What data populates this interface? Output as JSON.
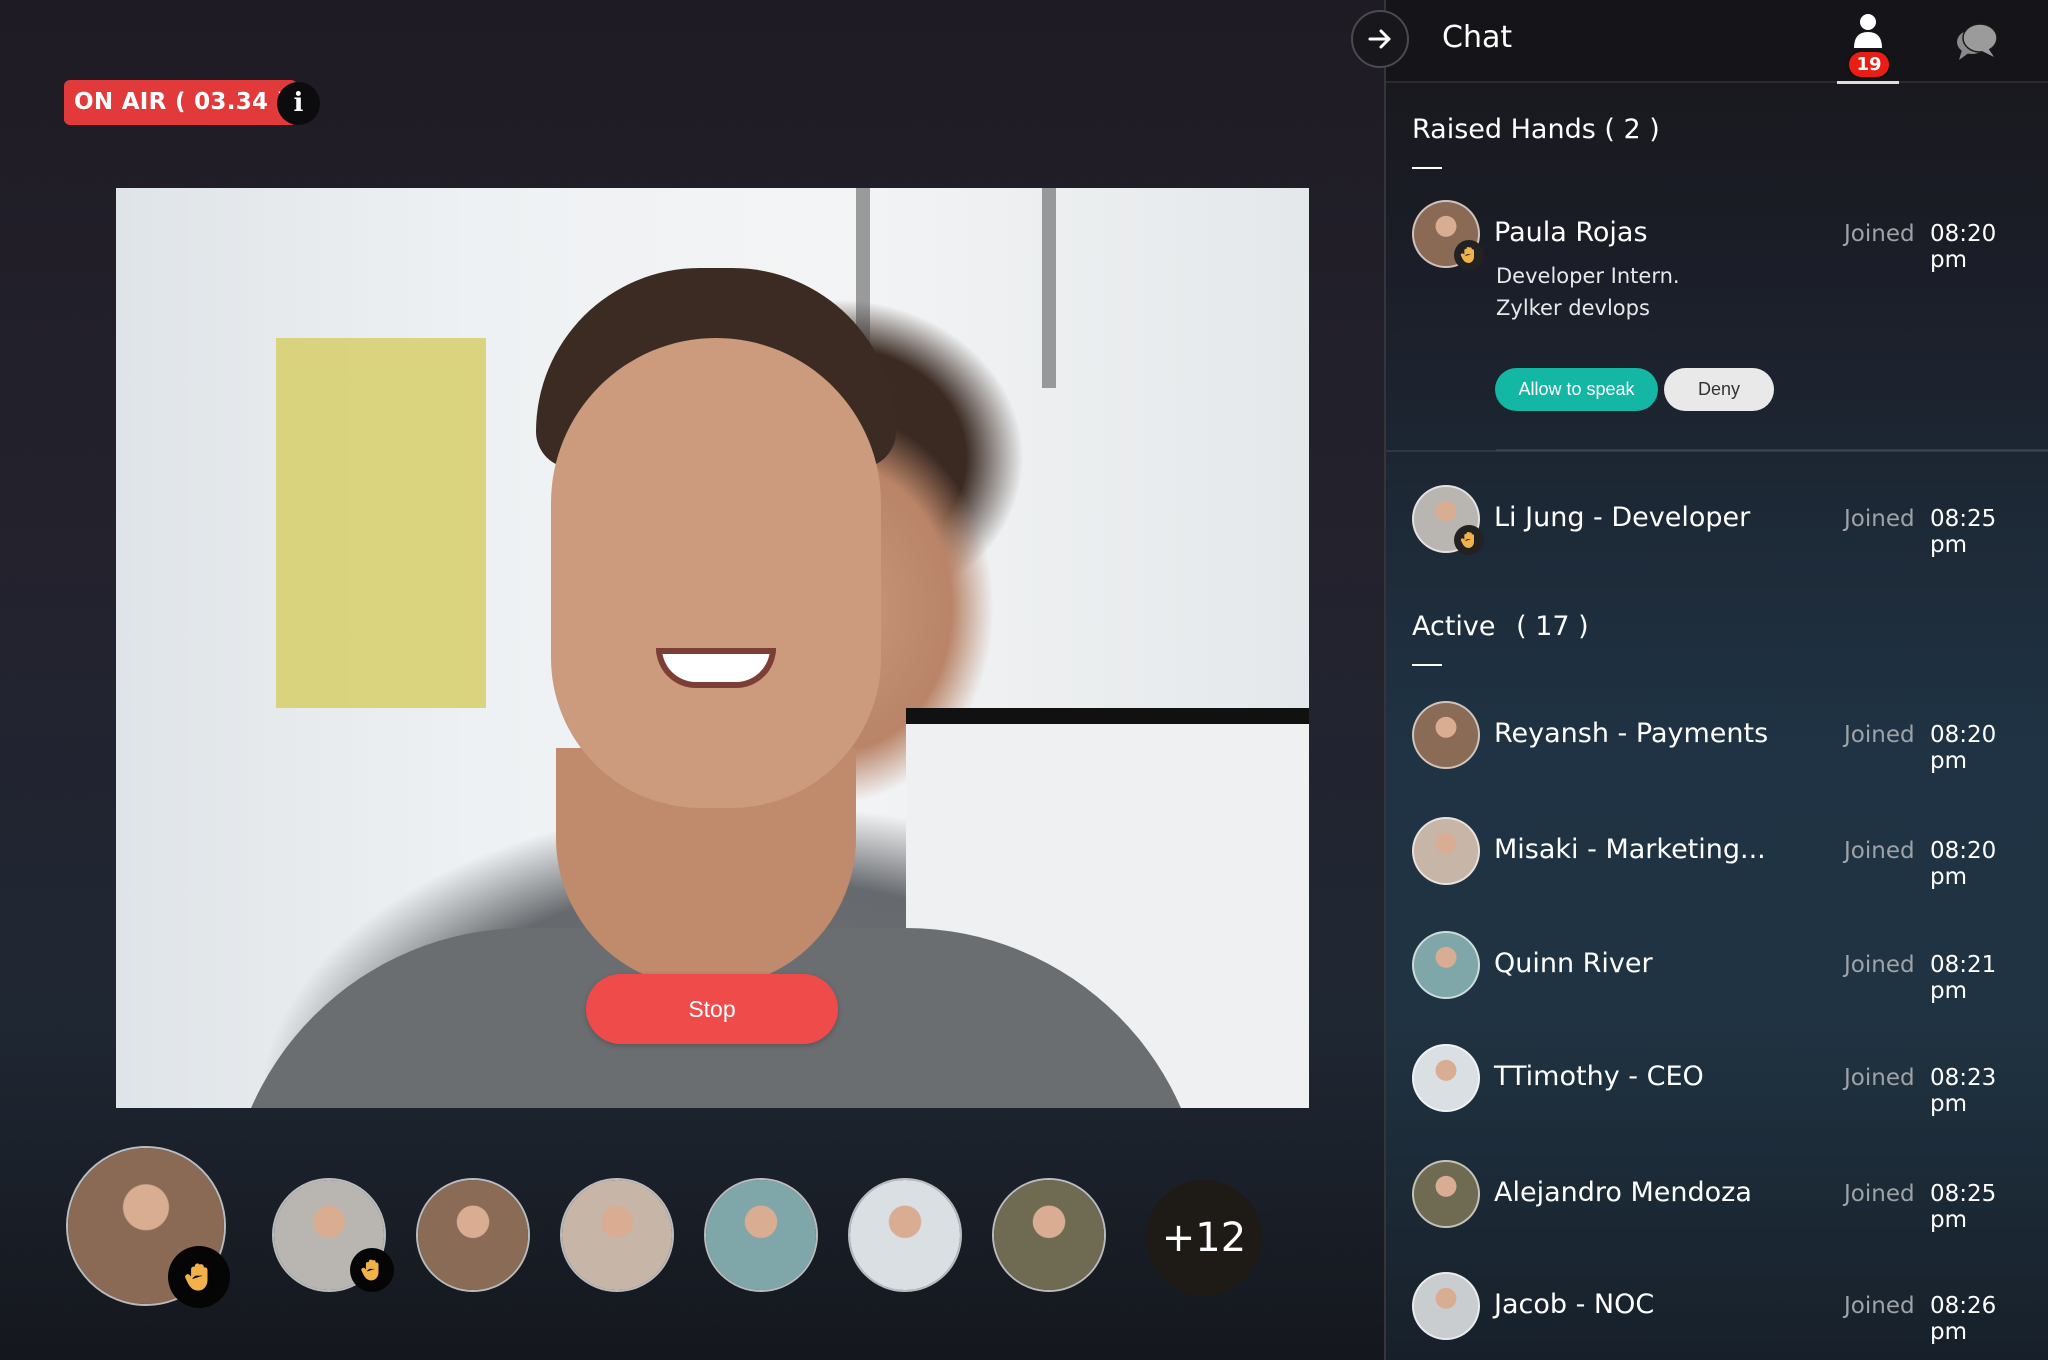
{
  "stage": {
    "on_air_label": "ON AIR ( 03.34 )",
    "info_label": "i",
    "stop_label": "Stop",
    "more_count_label": "+12",
    "strip": [
      {
        "name": "Paula Rojas",
        "raised_hand": true,
        "featured": true,
        "color": "#8a6a55"
      },
      {
        "name": "Li Jung",
        "raised_hand": true,
        "color": "#b9b6b2"
      },
      {
        "name": "Reyansh",
        "raised_hand": false,
        "color": "#8a6b55"
      },
      {
        "name": "Misaki",
        "raised_hand": false,
        "color": "#c7b5a8"
      },
      {
        "name": "Quinn River",
        "raised_hand": false,
        "color": "#7fa6a8"
      },
      {
        "name": "TTimothy",
        "raised_hand": false,
        "color": "#d9dfe3"
      },
      {
        "name": "Alejandro Mendoza",
        "raised_hand": false,
        "color": "#6f6a52"
      }
    ]
  },
  "panel": {
    "title": "Chat",
    "participants_count": "19",
    "icons": {
      "collapse": "arrow-right-icon",
      "people": "person-icon",
      "chat": "chat-bubbles-icon",
      "raised_hand": "raised-hand-icon"
    },
    "raised_hands": {
      "title": "Raised Hands ( 2 )",
      "items": [
        {
          "name": "Paula Rojas",
          "subtitle_line1": "Developer Intern.",
          "subtitle_line2": "Zylker devlops",
          "joined_label": "Joined",
          "time": "08:20 pm",
          "allow_label": "Allow to speak",
          "deny_label": "Deny",
          "color": "#8a6a55"
        },
        {
          "name": "Li Jung - Developer",
          "joined_label": "Joined",
          "time": "08:25 pm",
          "color": "#b9b6b2"
        }
      ]
    },
    "active": {
      "title": "Active",
      "count": "( 17 )",
      "items": [
        {
          "name": "Reyansh - Payments",
          "joined_label": "Joined",
          "time": "08:20 pm",
          "color": "#8a6b55"
        },
        {
          "name": "Misaki - Marketing...",
          "joined_label": "Joined",
          "time": "08:20 pm",
          "color": "#c7b5a8"
        },
        {
          "name": "Quinn River",
          "joined_label": "Joined",
          "time": "08:21 pm",
          "color": "#7fa6a8"
        },
        {
          "name": "TTimothy - CEO",
          "joined_label": "Joined",
          "time": "08:23 pm",
          "color": "#d9dfe3"
        },
        {
          "name": "Alejandro Mendoza",
          "joined_label": "Joined",
          "time": "08:25 pm",
          "color": "#6f6a52"
        },
        {
          "name": "Jacob - NOC",
          "joined_label": "Joined",
          "time": "08:26 pm",
          "color": "#c9cdd0"
        }
      ]
    }
  },
  "colors": {
    "on_air": "#e23a3a",
    "stop": "#f04b4b",
    "allow": "#14b6a4",
    "deny": "#e9e9ea",
    "badge": "#e81e15",
    "hand": "#f2b24a"
  }
}
